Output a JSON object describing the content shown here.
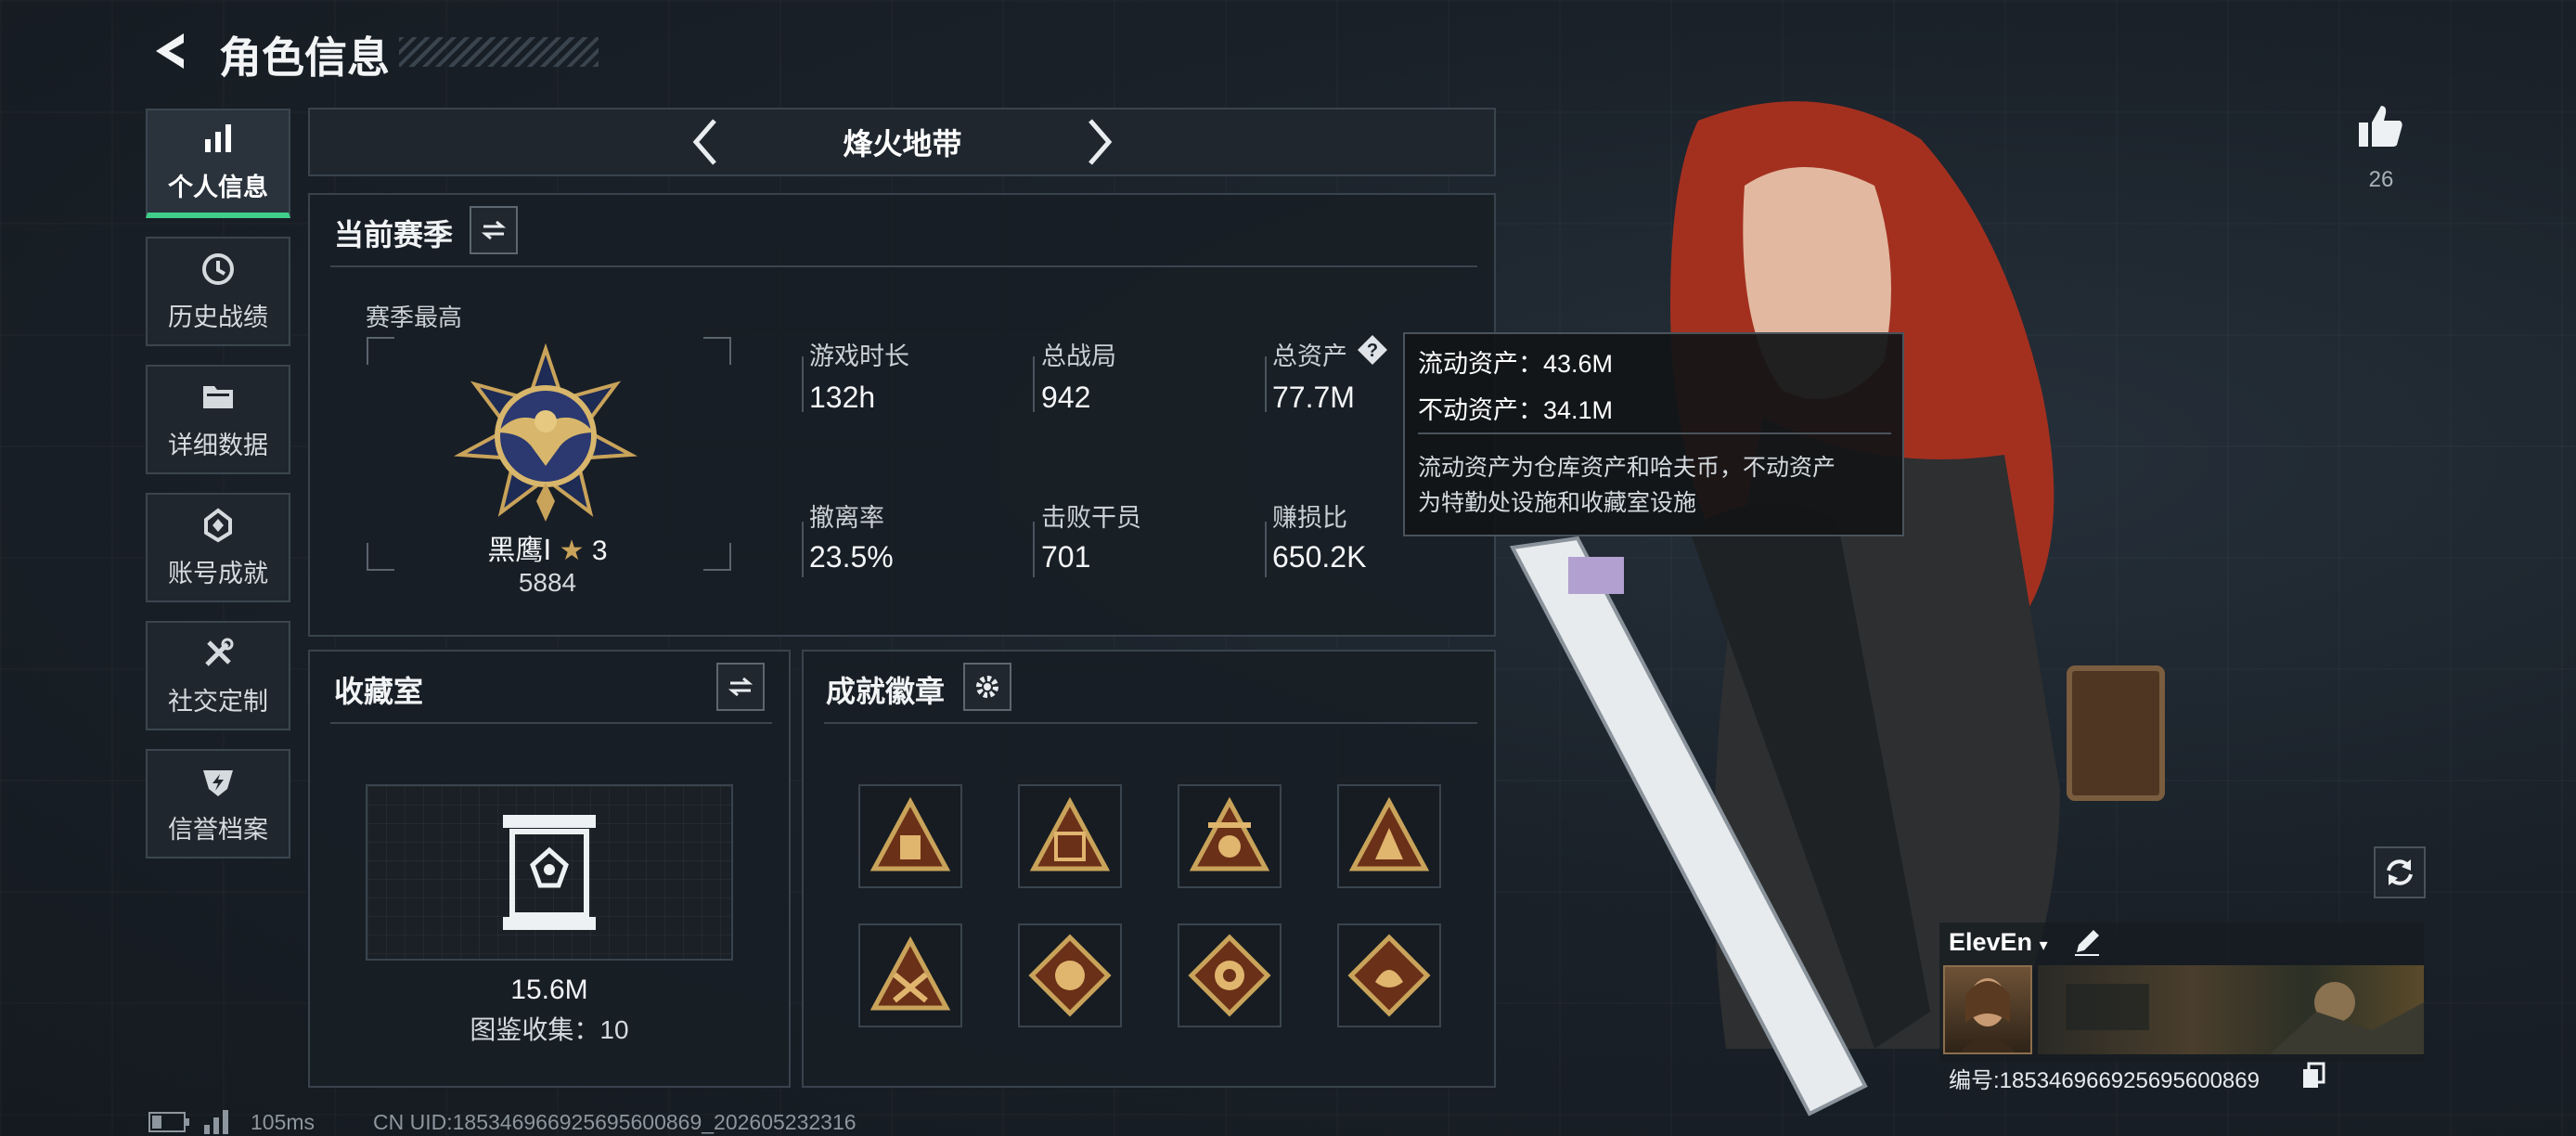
{
  "header": {
    "title": "角色信息"
  },
  "sidebar": {
    "items": [
      {
        "label": "个人信息",
        "icon": "bar-chart-icon",
        "active": true
      },
      {
        "label": "历史战绩",
        "icon": "history-clock-icon"
      },
      {
        "label": "详细数据",
        "icon": "folder-icon"
      },
      {
        "label": "账号成就",
        "icon": "achievement-icon"
      },
      {
        "label": "社交定制",
        "icon": "tools-icon"
      },
      {
        "label": "信誉档案",
        "icon": "credit-shield-icon"
      }
    ]
  },
  "mode_selector": {
    "label": "烽火地带"
  },
  "season": {
    "title": "当前赛季",
    "highest_label": "赛季最高",
    "rank_name": "黑鹰Ⅰ",
    "rank_stars": "3",
    "rank_points": "5884",
    "stats": [
      {
        "label": "游戏时长",
        "value": "132h"
      },
      {
        "label": "总战局",
        "value": "942"
      },
      {
        "label": "总资产",
        "value": "77.7M"
      },
      {
        "label": "撤离率",
        "value": "23.5%"
      },
      {
        "label": "击败干员",
        "value": "701"
      },
      {
        "label": "赚损比",
        "value": "650.2K"
      }
    ]
  },
  "tooltip": {
    "line1": "流动资产：43.6M",
    "line2": "不动资产：34.1M",
    "desc_line1": "流动资产为仓库资产和哈夫币，不动资产",
    "desc_line2": "为特勤处设施和收藏室设施"
  },
  "collection": {
    "title": "收藏室",
    "value": "15.6M",
    "count_text": "图鉴收集：10"
  },
  "achievements": {
    "title": "成就徽章",
    "badges": [
      "badge-icon-1",
      "badge-icon-2",
      "badge-icon-3",
      "badge-icon-4",
      "badge-icon-5",
      "badge-icon-6",
      "badge-icon-7",
      "badge-icon-8"
    ]
  },
  "like": {
    "count": "26"
  },
  "player": {
    "name": "ElevEn",
    "id_text": "编号:185346966925695600869"
  },
  "status_bar": {
    "ping": "105ms",
    "uid_text": "CN UID:185346966925695600869_202605232316"
  },
  "colors": {
    "accent_green": "#3fcf8a",
    "gold": "#c9a35a",
    "hair_red": "#a3301f"
  }
}
